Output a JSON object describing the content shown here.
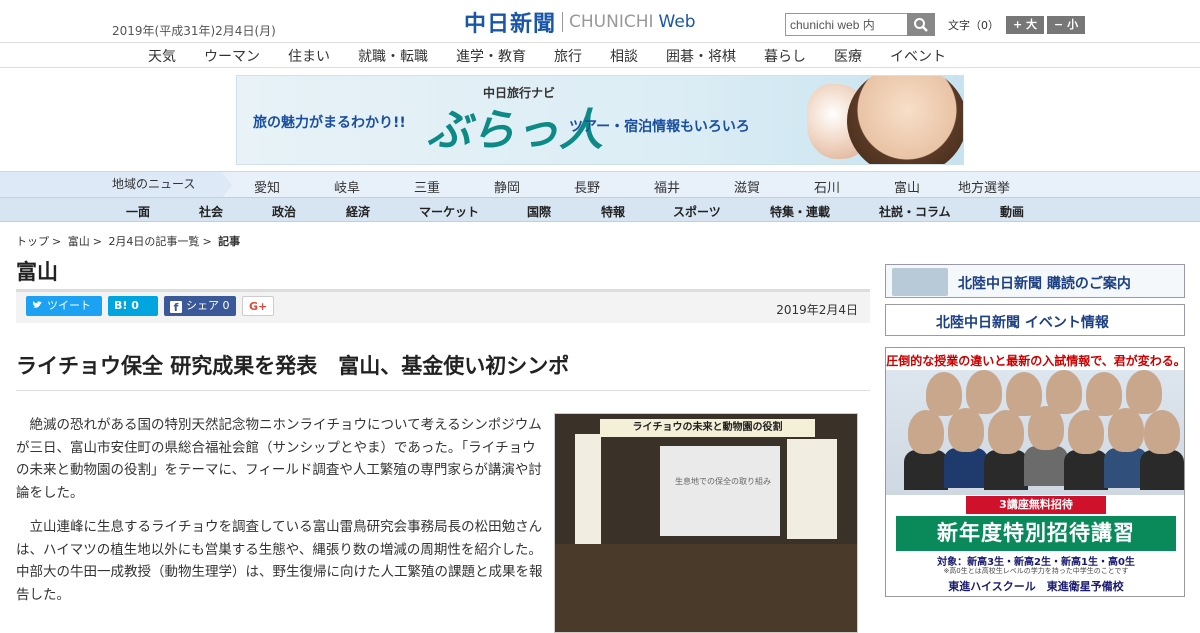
{
  "header": {
    "date": "2019年(平成31年)2月4日(月)",
    "logo_ja": "中日新聞",
    "logo_en": "CHUNICHI",
    "logo_web": "Web",
    "search_placeholder": "chunichi web 内",
    "font_label": "文字（0）",
    "font_plus": "+ 大",
    "font_minus": "− 小"
  },
  "category_nav": [
    "天気",
    "ウーマン",
    "住まい",
    "就職・転職",
    "進学・教育",
    "旅行",
    "相談",
    "囲碁・将棋",
    "暮らし",
    "医療",
    "イベント"
  ],
  "ad": {
    "left": "旅の魅力がまるわかり!!",
    "small": "中日旅行ナビ",
    "big": "ぶらっ人",
    "right": "ツアー・宿泊情報もいろいろ"
  },
  "region_nav": {
    "label": "地域のニュース",
    "items": [
      "愛知",
      "岐阜",
      "三重",
      "静岡",
      "長野",
      "福井",
      "滋賀",
      "石川",
      "富山",
      "地方選挙"
    ]
  },
  "main_nav": [
    "一面",
    "社会",
    "政治",
    "経済",
    "マーケット",
    "国際",
    "特報",
    "スポーツ",
    "特集・連載",
    "社説・コラム",
    "動画"
  ],
  "breadcrumb": [
    "トップ",
    "富山",
    "2月4日の記事一覧",
    "記事"
  ],
  "section_title": "富山",
  "share": {
    "tweet": "ツイート",
    "hatena": "B! 0",
    "facebook": "シェア 0",
    "gplus": "G+"
  },
  "article": {
    "date": "2019年2月4日",
    "headline": "ライチョウ保全 研究成果を発表　富山、基金使い初シンポ",
    "paragraphs": [
      "絶滅の恐れがある国の特別天然記念物ニホンライチョウについて考えるシンポジウムが三日、富山市安住町の県総合福祉会館（サンシップとやま）であった。「ライチョウの未来と動物園の役割」をテーマに、フィールド調査や人工繁殖の専門家らが講演や討論をした。",
      "立山連峰に生息するライチョウを調査している富山雷鳥研究会事務局長の松田勉さんは、ハイマツの植生地以外にも営巣する生態や、縄張り数の増減の周期性を紹介した。中部大の牛田一成教授（動物生理学）は、野生復帰に向けた人工繁殖の課題と成果を報告した。"
    ],
    "photo_banner": "ライチョウの未来と動物園の役割",
    "photo_screen": "生息地での保全の取り組み"
  },
  "sidebar": {
    "subscribe": "北陸中日新聞 購読のご案内",
    "events": "北陸中日新聞 イベント情報",
    "ad_head": "圧倒的な授業の違いと最新の入試情報で、君が変わる。",
    "ad_red": "3講座無料招待",
    "ad_green": "新年度特別招待講習",
    "ad_target": "対象：新高3生・新高2生・新高1生・高0生",
    "ad_note": "※高0生とは高校生レベルの学力を持った中学生のことです",
    "ad_brand": "東進ハイスクール　東進衛星予備校"
  }
}
